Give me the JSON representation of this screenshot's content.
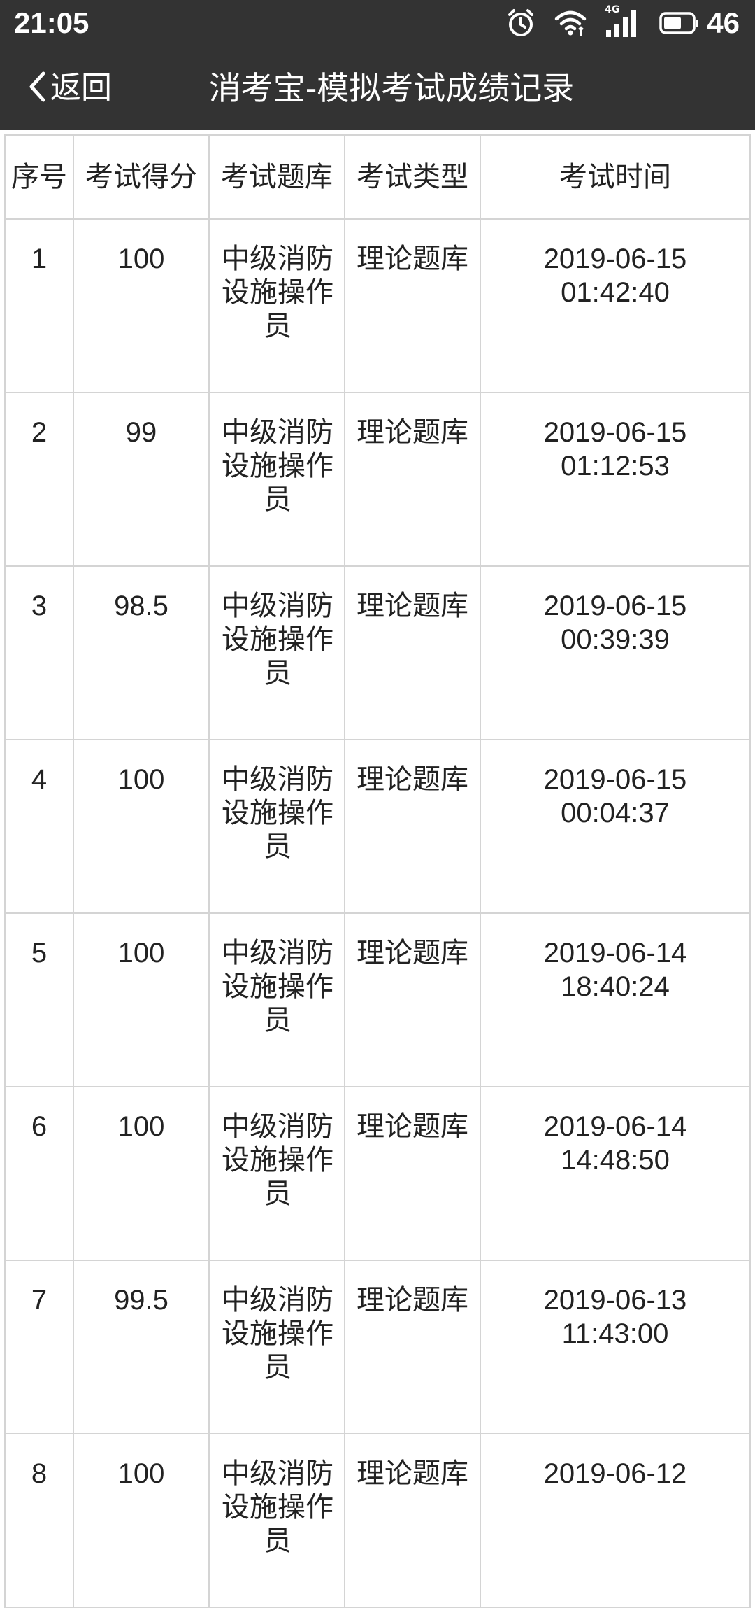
{
  "status_bar": {
    "time": "21:05",
    "network_label": "4G",
    "battery_level": "46",
    "icons": [
      "alarm-icon",
      "wifi-icon",
      "cellular-signal-icon",
      "battery-icon"
    ]
  },
  "nav": {
    "back_label": "返回",
    "title": "消考宝-模拟考试成绩记录"
  },
  "colors": {
    "header_bg": "#333333",
    "header_text": "#ffffff",
    "grid_line": "#d4d4d4",
    "body_text": "#222222"
  },
  "table": {
    "headers": [
      "序号",
      "考试得分",
      "考试题库",
      "考试类型",
      "考试时间"
    ],
    "rows": [
      {
        "index": "1",
        "score": "100",
        "bank": "中级消防设施操作员",
        "type": "理论题库",
        "date": "2019-06-15",
        "clock": "01:42:40"
      },
      {
        "index": "2",
        "score": "99",
        "bank": "中级消防设施操作员",
        "type": "理论题库",
        "date": "2019-06-15",
        "clock": "01:12:53"
      },
      {
        "index": "3",
        "score": "98.5",
        "bank": "中级消防设施操作员",
        "type": "理论题库",
        "date": "2019-06-15",
        "clock": "00:39:39"
      },
      {
        "index": "4",
        "score": "100",
        "bank": "中级消防设施操作员",
        "type": "理论题库",
        "date": "2019-06-15",
        "clock": "00:04:37"
      },
      {
        "index": "5",
        "score": "100",
        "bank": "中级消防设施操作员",
        "type": "理论题库",
        "date": "2019-06-14",
        "clock": "18:40:24"
      },
      {
        "index": "6",
        "score": "100",
        "bank": "中级消防设施操作员",
        "type": "理论题库",
        "date": "2019-06-14",
        "clock": "14:48:50"
      },
      {
        "index": "7",
        "score": "99.5",
        "bank": "中级消防设施操作员",
        "type": "理论题库",
        "date": "2019-06-13",
        "clock": "11:43:00"
      },
      {
        "index": "8",
        "score": "100",
        "bank": "中级消防设施操作员",
        "type": "理论题库",
        "date": "2019-06-12",
        "clock": ""
      }
    ]
  }
}
